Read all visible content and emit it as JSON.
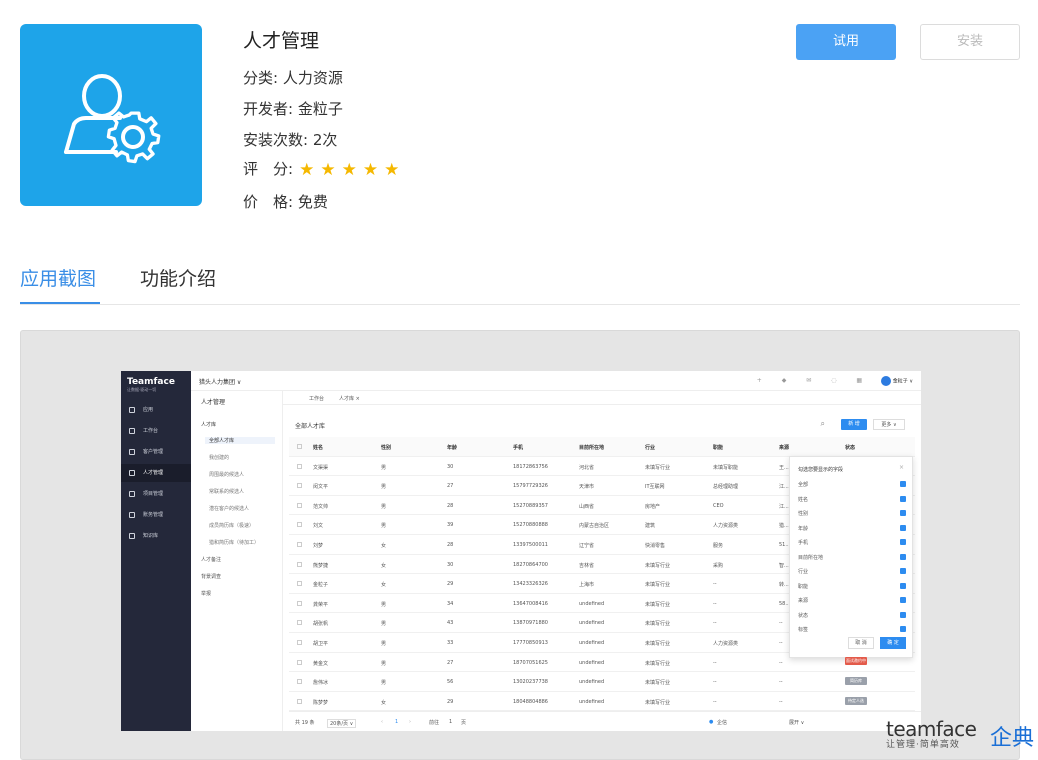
{
  "app": {
    "title": "人才管理",
    "category_label": "分类:",
    "category": "人力资源",
    "developer_label": "开发者:",
    "developer": "金粒子",
    "installs_label": "安装次数:",
    "installs": "2次",
    "rating_label": "评　分:",
    "rating": 5,
    "stars": [
      "★",
      "★",
      "★",
      "★",
      "★"
    ],
    "price_label": "价　格:",
    "price": "免费"
  },
  "actions": {
    "try": "试用",
    "install": "安装"
  },
  "tabs": [
    "应用截图",
    "功能介绍"
  ],
  "colors": {
    "accent": "#3a8ee6",
    "icon_bg": "#1ea4e9",
    "star": "#f5b800"
  },
  "screenshot": {
    "logo": "Teamface",
    "logo_sub": "让数据·驱动一切",
    "org": "猎头人力集团 ∨",
    "user": "金粒子 ∨",
    "nav": [
      "应用",
      "工作台",
      "客户管理",
      "人才管理",
      "项目管理",
      "账务管理",
      "知识库"
    ],
    "module": "人才管理",
    "tree": {
      "root": "人才库",
      "items": [
        "全部人才库",
        "我创建的",
        "周围最的候选人",
        "常联系的候选人",
        "潜在客户的候选人",
        "成员简历库（极速）",
        "猎和简历库（待加工）"
      ],
      "others": [
        "人才备注",
        "背景调查",
        "举报"
      ]
    },
    "tabs": [
      "工作台",
      "人才库 ×"
    ],
    "caption": "全部人才库",
    "new_btn": "新 增",
    "more_btn": "更多 ∨",
    "columns": [
      "姓名",
      "性别",
      "年龄",
      "手机",
      "目前所在地",
      "行业",
      "职能",
      "来源",
      "状态"
    ],
    "rows": [
      [
        "文渠渠",
        "男",
        "30",
        "18172863756",
        "河北省",
        "未填写行业",
        "未填写职能",
        "王..."
      ],
      [
        "闵文平",
        "男",
        "27",
        "15797729326",
        "天津市",
        "IT互联网",
        "总经理助理",
        "江..."
      ],
      [
        "范文帅",
        "男",
        "28",
        "15270889357",
        "山西省",
        "房地产",
        "CEO",
        "江..."
      ],
      [
        "刘文",
        "男",
        "39",
        "15270880888",
        "内蒙古自治区",
        "建筑",
        "人力资源类",
        "猎..."
      ],
      [
        "刘梦",
        "女",
        "28",
        "13397500011",
        "辽宁省",
        "快消零售",
        "服务",
        "51..."
      ],
      [
        "熊梦捷",
        "女",
        "30",
        "18270864700",
        "吉林省",
        "未填写行业",
        "采购",
        "智..."
      ],
      [
        "金粒子",
        "女",
        "29",
        "13423326326",
        "上海市",
        "未填写行业",
        "--",
        "转..."
      ],
      [
        "龚荣平",
        "男",
        "34",
        "13647008416",
        "undefined",
        "未填写行业",
        "--",
        "58..."
      ],
      [
        "胡张帆",
        "男",
        "43",
        "13870971880",
        "undefined",
        "未填写行业",
        "--",
        "--"
      ],
      [
        "胡卫平",
        "男",
        "33",
        "17770850913",
        "undefined",
        "未填写行业",
        "人力资源类",
        "--"
      ],
      [
        "黄金文",
        "男",
        "27",
        "18707051625",
        "undefined",
        "未填写行业",
        "--",
        "--"
      ],
      [
        "詹伟冰",
        "男",
        "56",
        "13020237738",
        "undefined",
        "未填写行业",
        "--",
        "--"
      ],
      [
        "陈梦梦",
        "女",
        "29",
        "18048804886",
        "undefined",
        "未填写行业",
        "--",
        "--"
      ]
    ],
    "panel": {
      "title": "勾选您要显示的字段",
      "options": [
        "全部",
        "姓名",
        "性别",
        "年龄",
        "手机",
        "目前所在地",
        "行业",
        "职能",
        "来源",
        "状态",
        "标签"
      ],
      "cancel": "取 消",
      "ok": "确 定"
    },
    "tags": [
      "面试邀约中",
      "简历库",
      "待定人选"
    ],
    "footer": {
      "total": "共 19 条",
      "per_page": "20条/页 ∨",
      "page": "1",
      "goto": "前往",
      "page_input": "1",
      "page_suffix": "页",
      "chat": "企信",
      "expand": "展开 ∨"
    }
  },
  "watermark": {
    "brand": "teamface",
    "slogan": "让管理·简单高效",
    "cn": "企典"
  }
}
